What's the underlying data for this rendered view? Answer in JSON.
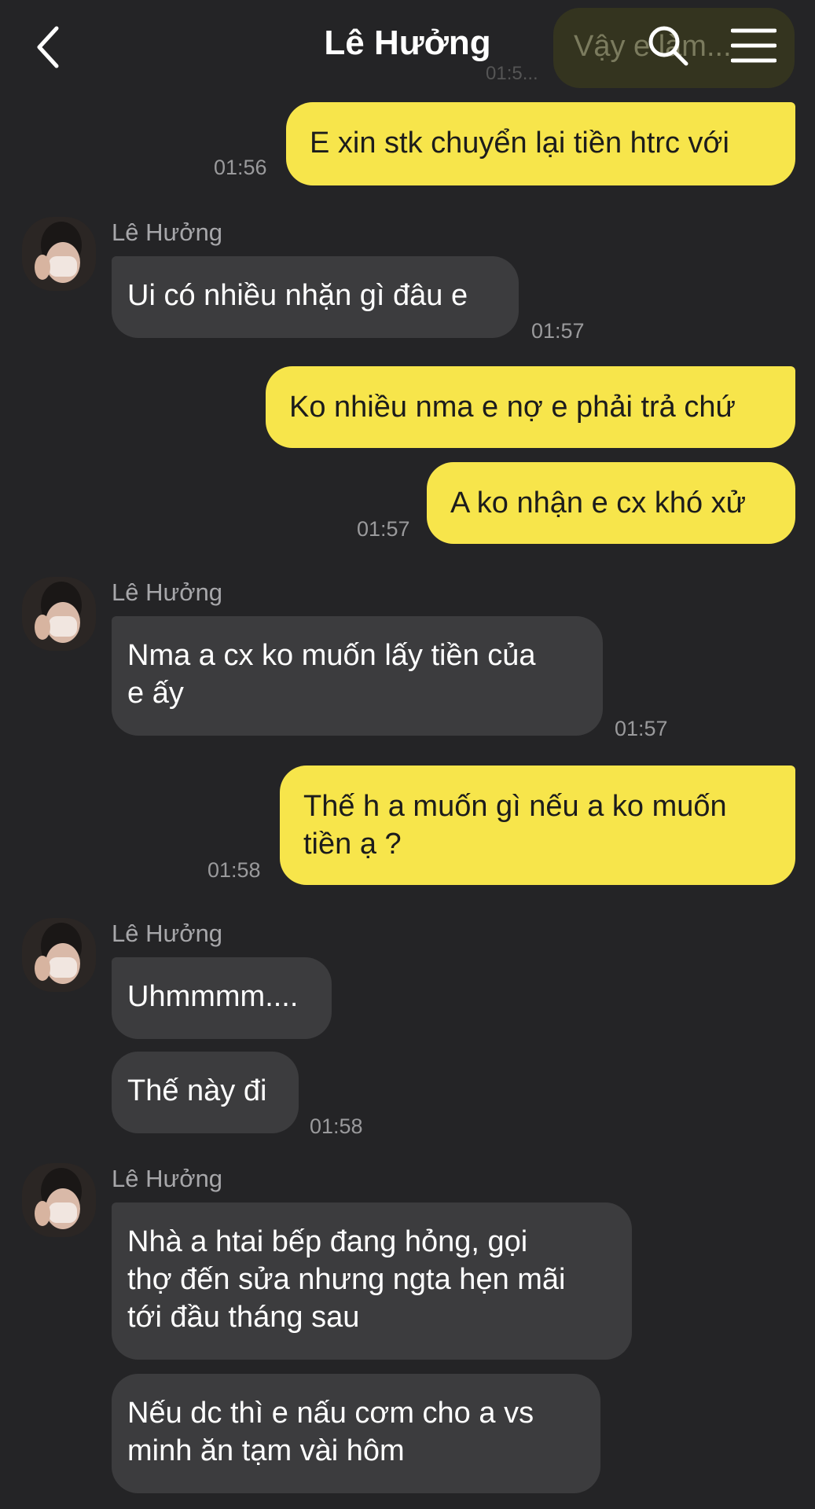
{
  "header": {
    "title": "Lê Hưởng",
    "ghost_text": "Vậy e làm...",
    "ghost_time": "01:5..."
  },
  "messages": {
    "m1": {
      "text": "E xin stk chuyển lại tiền htrc với",
      "time": "01:56"
    },
    "m2": {
      "sender": "Lê Hưởng",
      "text": "Ui có nhiều nhặn gì đâu e",
      "time": "01:57"
    },
    "m3": {
      "text": "Ko nhiều nma e nợ e phải trả chứ"
    },
    "m4": {
      "text": "A ko nhận e cx khó xử",
      "time": "01:57"
    },
    "m5": {
      "sender": "Lê Hưởng",
      "line1": "Nma a cx ko muốn lấy tiền của",
      "line2": "e ấy",
      "time": "01:57"
    },
    "m6": {
      "line1": "Thế h a muốn gì nếu a ko muốn",
      "line2": "tiền ạ ?",
      "time": "01:58"
    },
    "m7": {
      "sender": "Lê Hưởng",
      "text": "Uhmmmm...."
    },
    "m8": {
      "text": "Thế này đi",
      "time": "01:58"
    },
    "m9": {
      "sender": "Lê Hưởng",
      "line1": "Nhà a htai bếp đang hỏng, gọi",
      "line2": "thợ đến sửa nhưng ngta hẹn mãi",
      "line3": "tới đầu tháng sau"
    },
    "m10": {
      "line1": "Nếu dc thì e nấu cơm cho a vs",
      "line2": "minh ăn tạm vài hôm"
    }
  },
  "colors": {
    "background": "#242426",
    "outgoing_bubble": "#f7e54b",
    "incoming_bubble": "#3c3c3e"
  },
  "icons": [
    "back-chevron-icon",
    "search-icon",
    "menu-icon",
    "avatar"
  ]
}
